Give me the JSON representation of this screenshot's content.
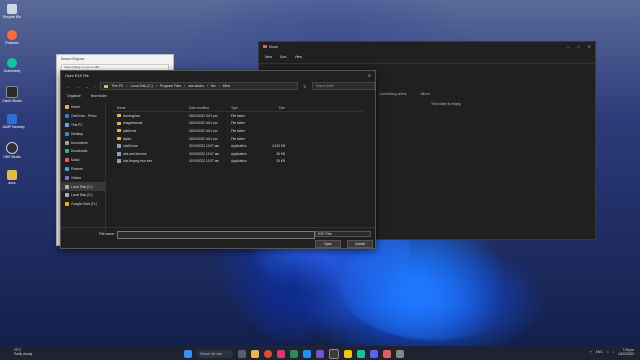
{
  "desktop": {
    "icons": [
      "Recycle Bin",
      "Postman",
      "Grammarly",
      "Camo Studio",
      "JUMP Desktop",
      "OBS Studio",
      "docs"
    ]
  },
  "browser_window": {
    "tab_title": "Search Engines",
    "address": "Search Bing or type a URL"
  },
  "music_window": {
    "title": "Music",
    "toolbar": [
      "New",
      "Sort",
      "View"
    ],
    "columns": [
      "Contributing artists",
      "Album"
    ],
    "empty_message": "This folder is empty."
  },
  "dialog": {
    "title": "Open EXE File",
    "breadcrumb": [
      "This PC",
      "Local Disk (C:)",
      "Program Files",
      "obs-studio",
      "bin",
      "64bit"
    ],
    "search_placeholder": "Search 64bit",
    "organize_label": "Organize",
    "new_folder_label": "New folder",
    "nav_items": [
      "Home",
      "OneDrive - Perso",
      "This PC",
      "Desktop",
      "Documents",
      "Downloads",
      "Music",
      "Pictures",
      "Videos",
      "Local Disk (C:)",
      "Local Disk (D:)",
      "Google Drive (G:)"
    ],
    "columns": [
      "Name",
      "Date modified",
      "Type",
      "Size"
    ],
    "files": [
      {
        "name": "iconengines",
        "date": "18/10/2022 5:01 pm",
        "type": "File folder",
        "size": "",
        "kind": "folder"
      },
      {
        "name": "imageformats",
        "date": "18/10/2022 5:01 pm",
        "type": "File folder",
        "size": "",
        "kind": "folder"
      },
      {
        "name": "platforms",
        "date": "18/10/2022 5:01 pm",
        "type": "File folder",
        "size": "",
        "kind": "folder"
      },
      {
        "name": "styles",
        "date": "18/10/2022 5:01 pm",
        "type": "File folder",
        "size": "",
        "kind": "folder"
      },
      {
        "name": "obs64.exe",
        "date": "02/10/2022 12:07 am",
        "type": "Application",
        "size": "4,319 KB",
        "kind": "exe"
      },
      {
        "name": "obs-amf-test.exe",
        "date": "02/10/2022 12:07 am",
        "type": "Application",
        "size": "26 KB",
        "kind": "exe"
      },
      {
        "name": "obs-ffmpeg-mux.exe",
        "date": "02/10/2022 12:07 am",
        "type": "Application",
        "size": "33 KB",
        "kind": "exe"
      }
    ],
    "filename_label": "File name:",
    "filename_value": "",
    "filetype": "EXE Files",
    "open_label": "Open",
    "cancel_label": "Cancel"
  },
  "taskbar": {
    "weather_temp": "22°C",
    "weather_desc": "Partly cloudy",
    "search_label": "Search the web",
    "lang": "ENG",
    "time": "7:18 pm",
    "date": "18/10/2022"
  }
}
